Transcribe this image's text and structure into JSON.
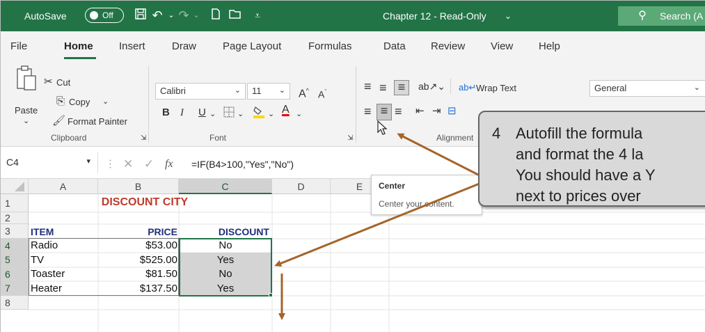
{
  "titlebar": {
    "autosave_label": "AutoSave",
    "autosave_state": "Off",
    "doc_title": "Chapter 12  -  Read-Only",
    "search_label": "Search (A"
  },
  "tabs": [
    "File",
    "Home",
    "Insert",
    "Draw",
    "Page Layout",
    "Formulas",
    "Data",
    "Review",
    "View",
    "Help"
  ],
  "active_tab": "Home",
  "ribbon": {
    "clipboard": {
      "paste": "Paste",
      "cut": "Cut",
      "copy": "Copy",
      "format_painter": "Format Painter",
      "group": "Clipboard"
    },
    "font": {
      "name": "Calibri",
      "size": "11",
      "group": "Font",
      "bold": "B",
      "italic": "I",
      "underline": "U"
    },
    "alignment": {
      "wrap_text": "Wrap Text",
      "group": "Alignment"
    },
    "number": {
      "format": "General"
    }
  },
  "formula_bar": {
    "name_box": "C4",
    "fx": "fx",
    "formula": "=IF(B4>100,\"Yes\",\"No\")"
  },
  "tooltip": {
    "title": "Center",
    "text": "Center your content."
  },
  "columns": [
    "A",
    "B",
    "C",
    "D",
    "E"
  ],
  "rows": [
    "1",
    "2",
    "3",
    "4",
    "5",
    "6",
    "7",
    "8"
  ],
  "sheet": {
    "title": "DISCOUNT CITY",
    "headers": {
      "item": "ITEM",
      "price": "PRICE",
      "discount": "DISCOUNT"
    },
    "data": [
      {
        "item": "Radio",
        "price": "$53.00",
        "discount": "No"
      },
      {
        "item": "TV",
        "price": "$525.00",
        "discount": "Yes"
      },
      {
        "item": "Toaster",
        "price": "$81.50",
        "discount": "No"
      },
      {
        "item": "Heater",
        "price": "$137.50",
        "discount": "Yes"
      }
    ]
  },
  "callout": {
    "number": "4",
    "lines": [
      "Autofill the formula",
      "and format the 4 la",
      "You should have a Y",
      "next to prices over"
    ]
  },
  "colors": {
    "excel_green": "#227447",
    "title_red": "#c0392b",
    "header_navy": "#1f2f7a",
    "arrow_brown": "#a5642a"
  }
}
